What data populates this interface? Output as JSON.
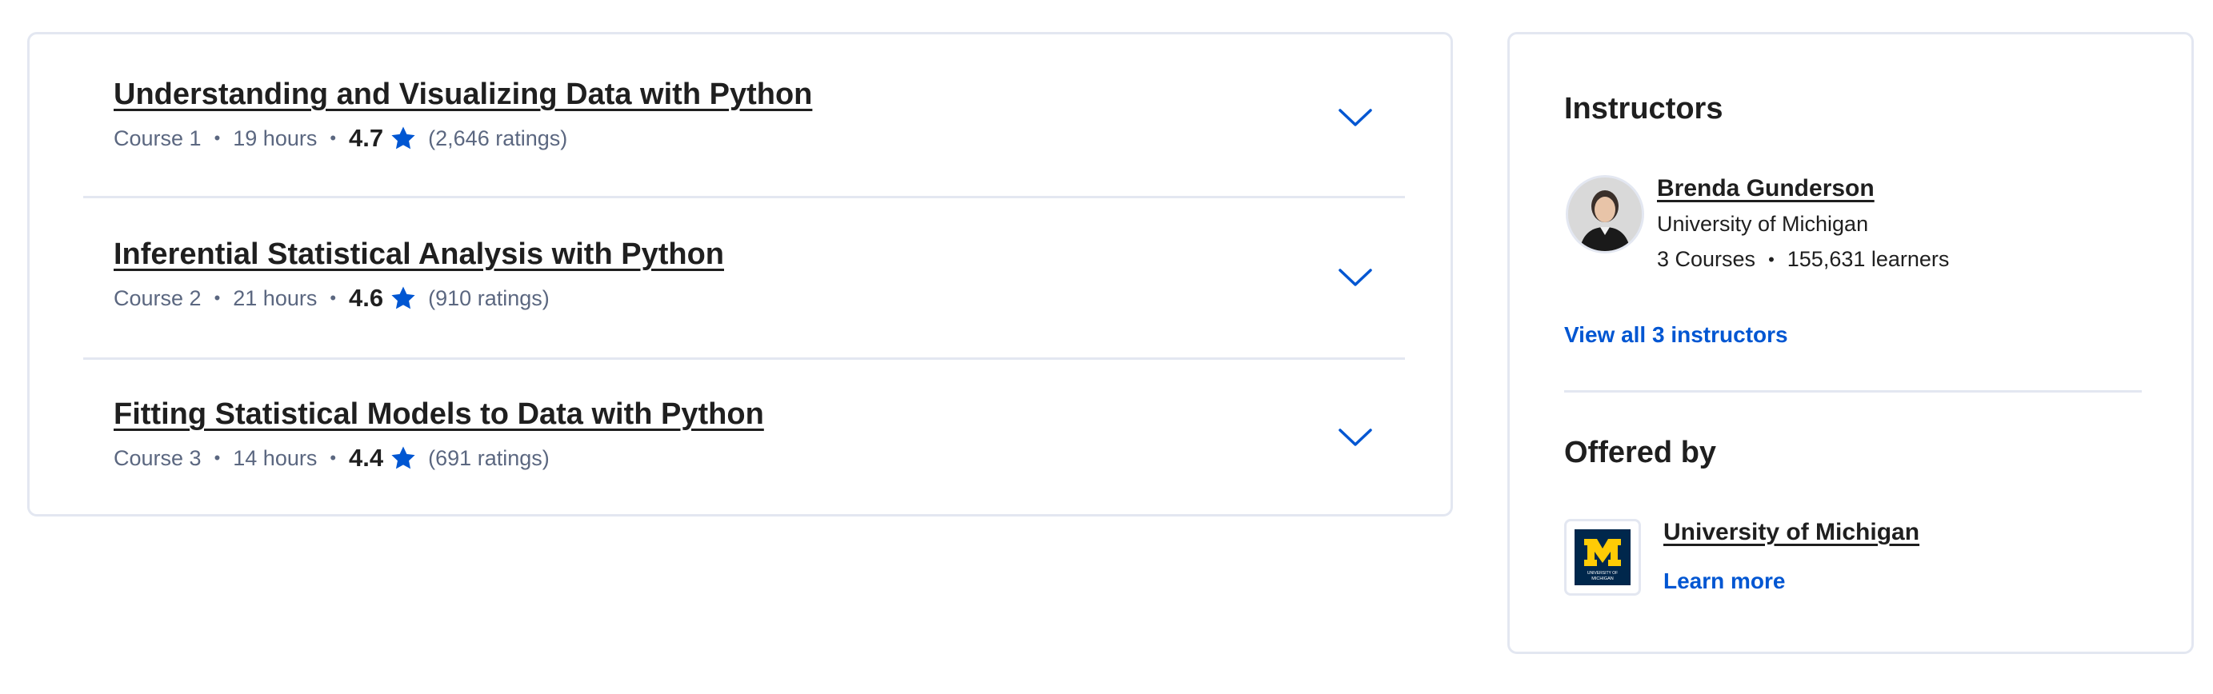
{
  "courses": [
    {
      "title": "Understanding and Visualizing Data with Python",
      "course_num": "Course 1",
      "hours": "19 hours",
      "rating": "4.7",
      "ratings_count": "(2,646 ratings)"
    },
    {
      "title": "Inferential Statistical Analysis with Python",
      "course_num": "Course 2",
      "hours": "21 hours",
      "rating": "4.6",
      "ratings_count": "(910 ratings)"
    },
    {
      "title": "Fitting Statistical Models to Data with Python",
      "course_num": "Course 3",
      "hours": "14 hours",
      "rating": "4.4",
      "ratings_count": "(691 ratings)"
    }
  ],
  "separator": "•",
  "instructors": {
    "heading": "Instructors",
    "name": "Brenda Gunderson",
    "org": "University of Michigan",
    "courses": "3 Courses",
    "learners": "155,631 learners",
    "view_all": "View all 3 instructors"
  },
  "offered_by": {
    "heading": "Offered by",
    "name": "University of Michigan",
    "learn_more": "Learn more",
    "logo_text": "UNIVERSITY OF MICHIGAN"
  },
  "colors": {
    "accent": "#0056d2",
    "border": "#e3e7f1",
    "meta": "#5b6780",
    "logo_navy": "#00274c",
    "logo_maize": "#ffcb05"
  },
  "icons": [
    "star-icon",
    "chevron-down-icon",
    "university-logo"
  ]
}
